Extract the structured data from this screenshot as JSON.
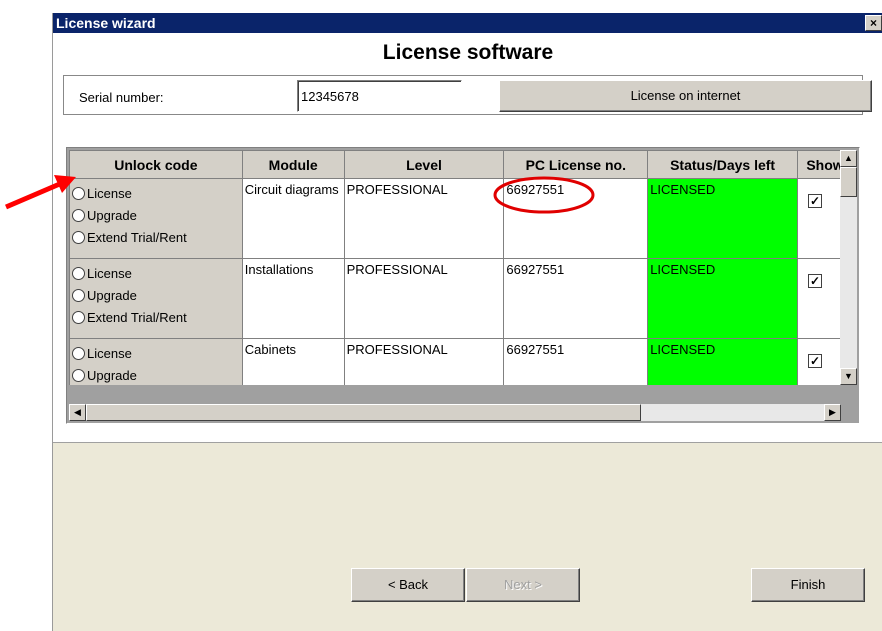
{
  "window": {
    "title": "License wizard",
    "close_glyph": "×"
  },
  "page": {
    "title": "License software"
  },
  "serial": {
    "label": "Serial number:",
    "value": "12345678"
  },
  "internet_button": "License on internet",
  "grid": {
    "headers": [
      "Unlock code",
      "Module",
      "Level",
      "PC License no.",
      "Status/Days left",
      "Show"
    ],
    "radio_options": [
      "License",
      "Upgrade",
      "Extend Trial/Rent"
    ],
    "rows": [
      {
        "module": "Circuit diagrams",
        "level": "PROFESSIONAL",
        "pc_license": "66927551",
        "status": "LICENSED",
        "show": true
      },
      {
        "module": "Installations",
        "level": "PROFESSIONAL",
        "pc_license": "66927551",
        "status": "LICENSED",
        "show": true
      },
      {
        "module": "Cabinets",
        "level": "PROFESSIONAL",
        "pc_license": "66927551",
        "status": "LICENSED",
        "show": true
      }
    ],
    "status_color": "#00ff00"
  },
  "footer": {
    "back": "< Back",
    "next": "Next >",
    "finish": "Finish"
  },
  "annotations": {
    "arrow_color": "#ff0000",
    "circle_color": "#e00000"
  }
}
